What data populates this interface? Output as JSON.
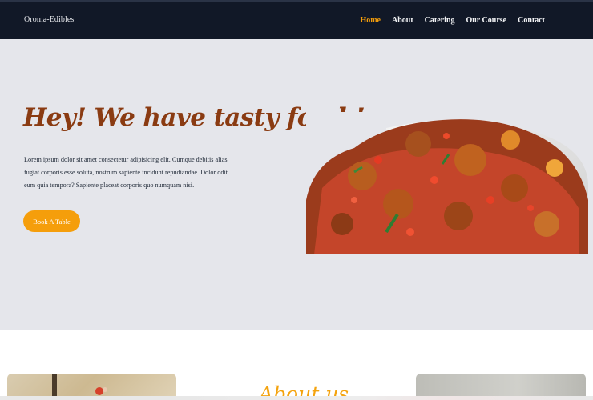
{
  "navbar": {
    "brand": "Oroma-Edibles",
    "links": [
      {
        "label": "Home",
        "active": true
      },
      {
        "label": "About",
        "active": false
      },
      {
        "label": "Catering",
        "active": false
      },
      {
        "label": "Our Course",
        "active": false
      },
      {
        "label": "Contact",
        "active": false
      }
    ]
  },
  "hero": {
    "title": "Hey! We have tasty food !",
    "text": "Lorem ipsum dolor sit amet consectetur adipisicing elit. Cumque debitis alias fugiat corporis esse soluta, nostrum sapiente incidunt repudiandae. Dolor odit eum quia tempora? Sapiente placeat corporis quo numquam nisi.",
    "button_label": "Book A Table"
  },
  "about": {
    "title": "About us"
  },
  "colors": {
    "nav_bg": "#111827",
    "accent": "#f59e0b",
    "hero_bg": "#e5e6eb",
    "title": "#8a3b12"
  }
}
